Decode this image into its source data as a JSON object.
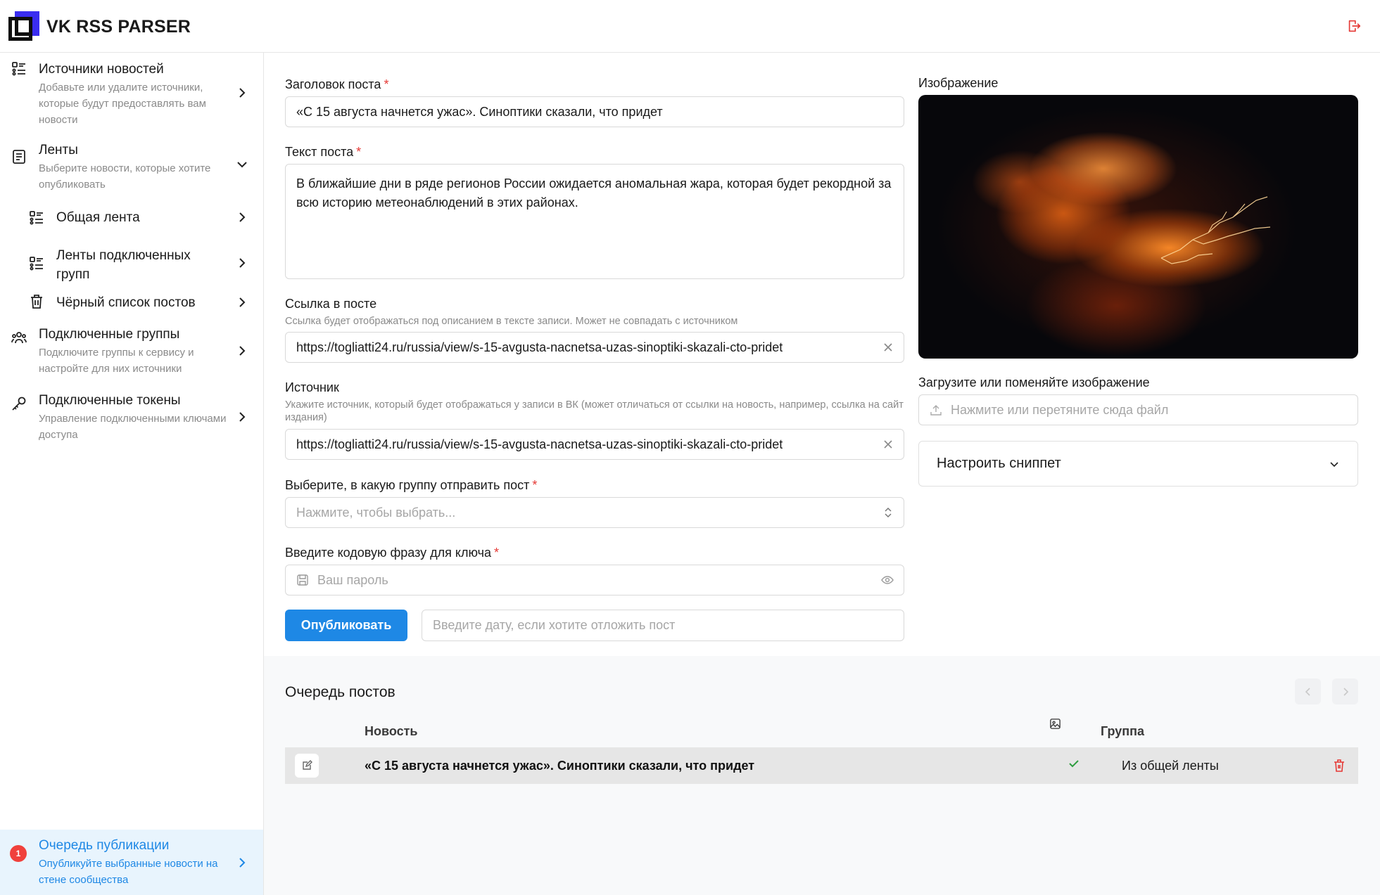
{
  "app": {
    "title": "VK RSS PARSER"
  },
  "header": {
    "logout_icon": "logout-icon"
  },
  "sidebar": {
    "items": [
      {
        "title": "Источники новостей",
        "desc": "Добавьте или удалите источники, которые будут предоставлять вам новости",
        "icon": "list-icon"
      },
      {
        "title": "Ленты",
        "desc": "Выберите новости, которые хотите опубликовать",
        "icon": "feed-icon",
        "expanded": true
      },
      {
        "title": "Общая лента",
        "icon": "list-icon"
      },
      {
        "title": "Ленты подключенных групп",
        "icon": "list-icon"
      },
      {
        "title": "Чёрный список постов",
        "icon": "trash-icon"
      },
      {
        "title": "Подключенные группы",
        "desc": "Подключите группы к сервису и настройте для них источники",
        "icon": "users-icon"
      },
      {
        "title": "Подключенные токены",
        "desc": "Управление подключенными ключами доступа",
        "icon": "key-icon"
      },
      {
        "title": "Очередь публикации",
        "desc": "Опубликуйте выбранные новости на стене сообщества",
        "badge": "1",
        "active": true
      }
    ]
  },
  "form": {
    "post_title": {
      "label": "Заголовок поста",
      "value": "«С 15 августа начнется ужас». Синоптики сказали, что придет"
    },
    "post_text": {
      "label": "Текст поста",
      "value": "В ближайшие дни в ряде регионов России ожидается аномальная жара, которая будет рекордной за всю историю метеонаблюдений в этих районах."
    },
    "link": {
      "label": "Ссылка в посте",
      "hint": "Ссылка будет отображаться под описанием в тексте записи. Может не совпадать с источником",
      "value": "https://togliatti24.ru/russia/view/s-15-avgusta-nacnetsa-uzas-sinoptiki-skazali-cto-pridet"
    },
    "source": {
      "label": "Источник",
      "hint": "Укажите источник, который будет отображаться у записи в ВК (может отличаться от ссылки на новость, например, ссылка на сайт издания)",
      "value": "https://togliatti24.ru/russia/view/s-15-avgusta-nacnetsa-uzas-sinoptiki-skazali-cto-pridet"
    },
    "group": {
      "label": "Выберите, в какую группу отправить пост",
      "placeholder": "Нажмите, чтобы выбрать..."
    },
    "passphrase": {
      "label": "Введите кодовую фразу для ключа",
      "placeholder": "Ваш пароль"
    },
    "publish_button": "Опубликовать",
    "date": {
      "placeholder": "Введите дату, если хотите отложить пост"
    }
  },
  "image_panel": {
    "label": "Изображение",
    "upload_label": "Загрузите или поменяйте изображение",
    "upload_placeholder": "Нажмите или перетяните сюда файл",
    "snippet_label": "Настроить сниппет"
  },
  "queue": {
    "title": "Очередь постов",
    "columns": {
      "news": "Новость",
      "image_icon": "image-icon",
      "group": "Группа"
    },
    "rows": [
      {
        "news": "«С 15 августа начнется ужас». Синоптики сказали, что придет",
        "has_image": true,
        "group": "Из общей ленты"
      }
    ]
  },
  "colors": {
    "accent": "#1e88e5",
    "danger": "#e53935",
    "success": "#2e9d3f",
    "badge": "#f0413c"
  }
}
